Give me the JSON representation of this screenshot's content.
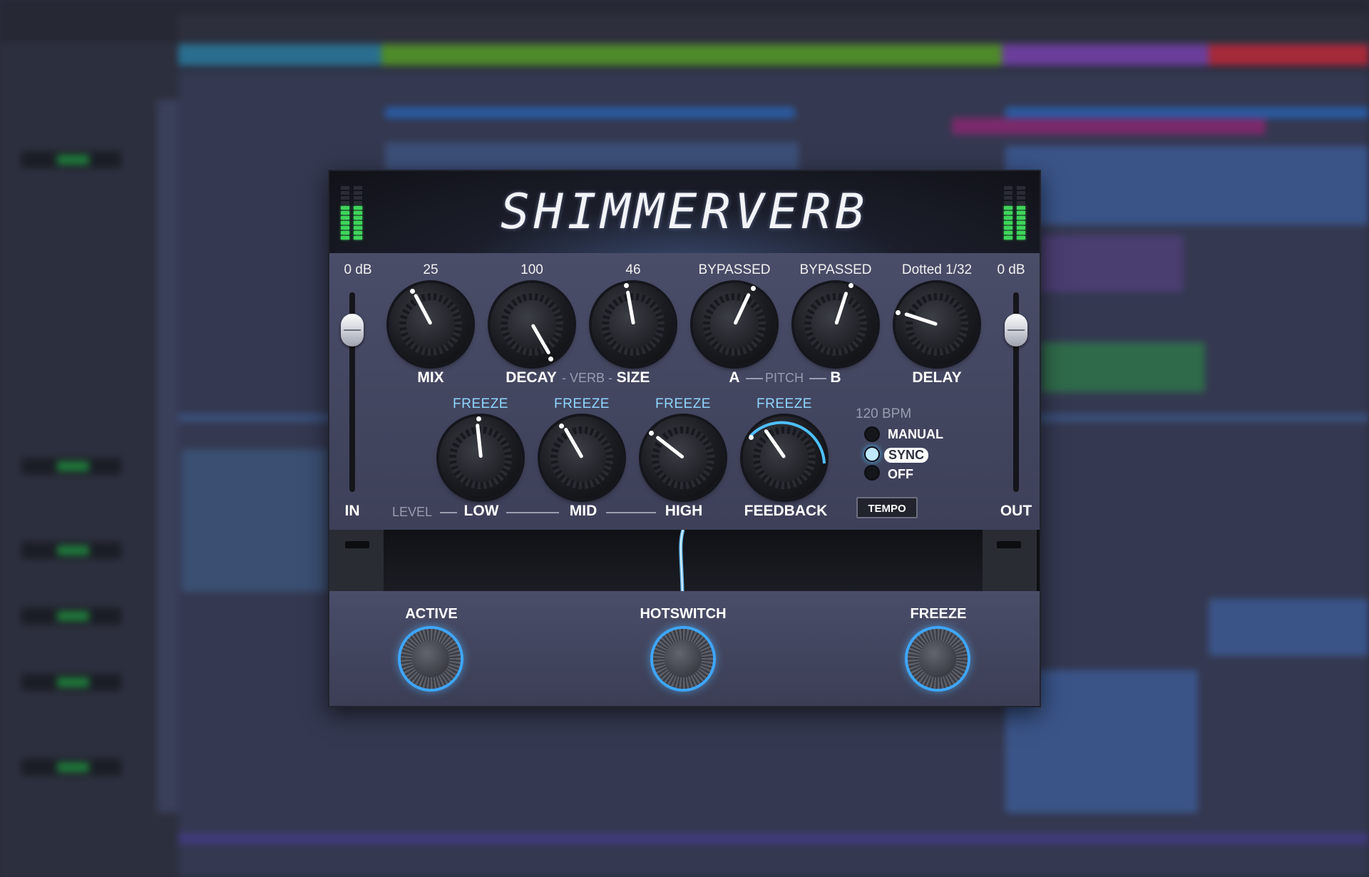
{
  "plugin": {
    "title": "SHIMMERVERB",
    "accent": "#4fc0ff",
    "meter_color": "#3fd45a",
    "input": {
      "value": "0 dB",
      "label": "IN"
    },
    "output": {
      "value": "0 dB",
      "label": "OUT"
    },
    "knobs_top": [
      {
        "id": "mix",
        "value": "25",
        "label": "MIX"
      },
      {
        "id": "decay",
        "value": "100",
        "label": "DECAY"
      },
      {
        "id": "size",
        "value": "46",
        "label": "SIZE"
      },
      {
        "id": "pitch-a",
        "value": "BYPASSED",
        "label": "A"
      },
      {
        "id": "pitch-b",
        "value": "BYPASSED",
        "label": "B"
      },
      {
        "id": "delay",
        "value": "Dotted 1/32",
        "label": "DELAY"
      }
    ],
    "group_labels": {
      "verb": "VERB",
      "pitch": "PITCH",
      "level": "LEVEL"
    },
    "knobs_bottom": [
      {
        "id": "low",
        "freeze": "FREEZE",
        "label": "LOW"
      },
      {
        "id": "mid",
        "freeze": "FREEZE",
        "label": "MID"
      },
      {
        "id": "high",
        "freeze": "FREEZE",
        "label": "HIGH"
      },
      {
        "id": "feedback",
        "freeze": "FREEZE",
        "label": "FEEDBACK"
      }
    ],
    "tempo": {
      "bpm": "120 BPM",
      "modes": [
        "MANUAL",
        "SYNC",
        "OFF"
      ],
      "selected": "SYNC",
      "button": "TEMPO"
    },
    "footswitches": [
      {
        "id": "active",
        "label": "ACTIVE"
      },
      {
        "id": "hotswitch",
        "label": "HOTSWITCH"
      },
      {
        "id": "freeze",
        "label": "FREEZE"
      }
    ]
  }
}
